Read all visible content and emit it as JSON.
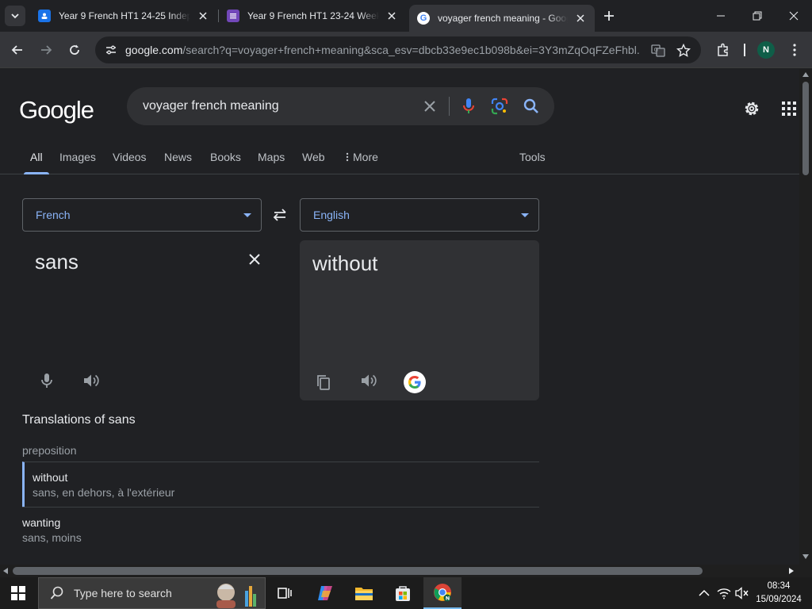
{
  "browser": {
    "tabs": [
      {
        "title": "Year 9 French HT1 24-25 Indepen",
        "favicon": "google-classroom-icon",
        "color": "#1a73e8"
      },
      {
        "title": "Year 9 French HT1 23-24 Week 1",
        "favicon": "google-forms-icon",
        "color": "#7248b9"
      },
      {
        "title": "voyager french meaning - Goog",
        "favicon": "google-g-icon",
        "active": true
      }
    ],
    "url_host": "google.com",
    "url_path": "/search?q=voyager+french+meaning&sca_esv=dbcb33e9ec1b098b&ei=3Y3mZqOqFZeFhbl...",
    "profile_initial": "N"
  },
  "search": {
    "logo": "Google",
    "query": "voyager french meaning",
    "tabs": [
      "All",
      "Images",
      "Videos",
      "News",
      "Books",
      "Maps",
      "Web",
      "More"
    ],
    "active_tab": "All",
    "tools_label": "Tools"
  },
  "translator": {
    "source_lang": "French",
    "target_lang": "English",
    "source_text": "sans",
    "target_text": "without"
  },
  "translations": {
    "title": "Translations of sans",
    "part_of_speech": "preposition",
    "entries": [
      {
        "word": "without",
        "synonyms": "sans, en dehors, à l'extérieur",
        "highlighted": true
      },
      {
        "word": "wanting",
        "synonyms": "sans, moins"
      }
    ]
  },
  "taskbar": {
    "search_placeholder": "Type here to search",
    "time": "08:34",
    "date": "15/09/2024"
  },
  "colors": {
    "accent": "#8ab4f8",
    "background": "#202124"
  }
}
